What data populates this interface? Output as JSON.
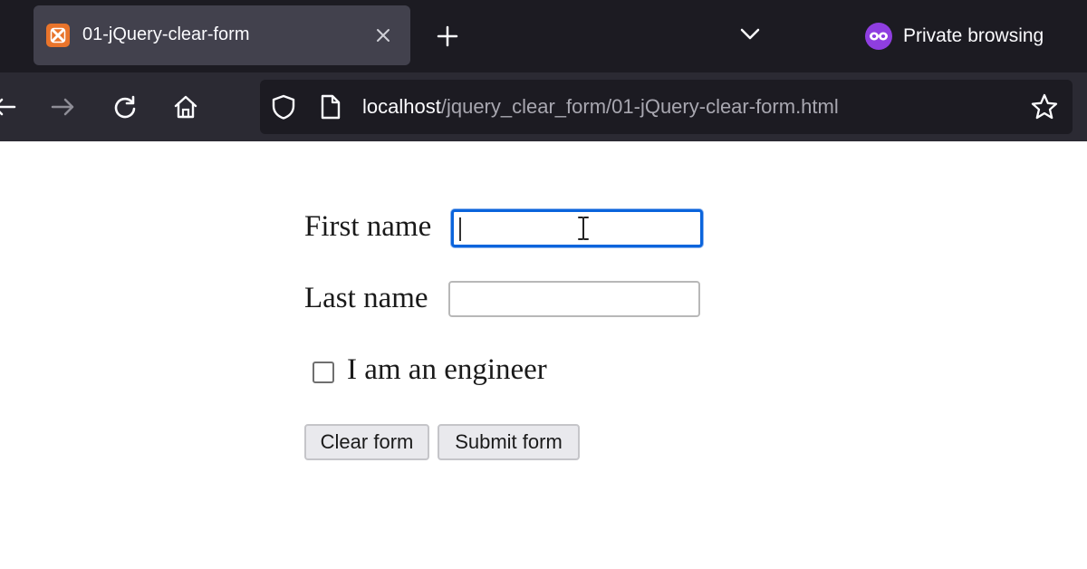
{
  "browser": {
    "tab": {
      "title": "01-jQuery-clear-form",
      "favicon": "xampp-icon",
      "close_icon": "close-icon"
    },
    "new_tab_icon": "plus-icon",
    "tab_list_icon": "chevron-down-icon",
    "private_label": "Private browsing",
    "url": {
      "host": "localhost",
      "path": "/jquery_clear_form/01-jQuery-clear-form.html"
    }
  },
  "form": {
    "first_name_label": "First name",
    "first_name_value": "",
    "last_name_label": "Last name",
    "last_name_value": "",
    "engineer_label": "I am an engineer",
    "engineer_checked": false,
    "clear_button": "Clear form",
    "submit_button": "Submit form"
  },
  "colors": {
    "tabbar_bg": "#1c1b22",
    "navbar_bg": "#2b2a33",
    "focus_ring": "#0a64dc",
    "private_accent": "#8f3ee0"
  }
}
